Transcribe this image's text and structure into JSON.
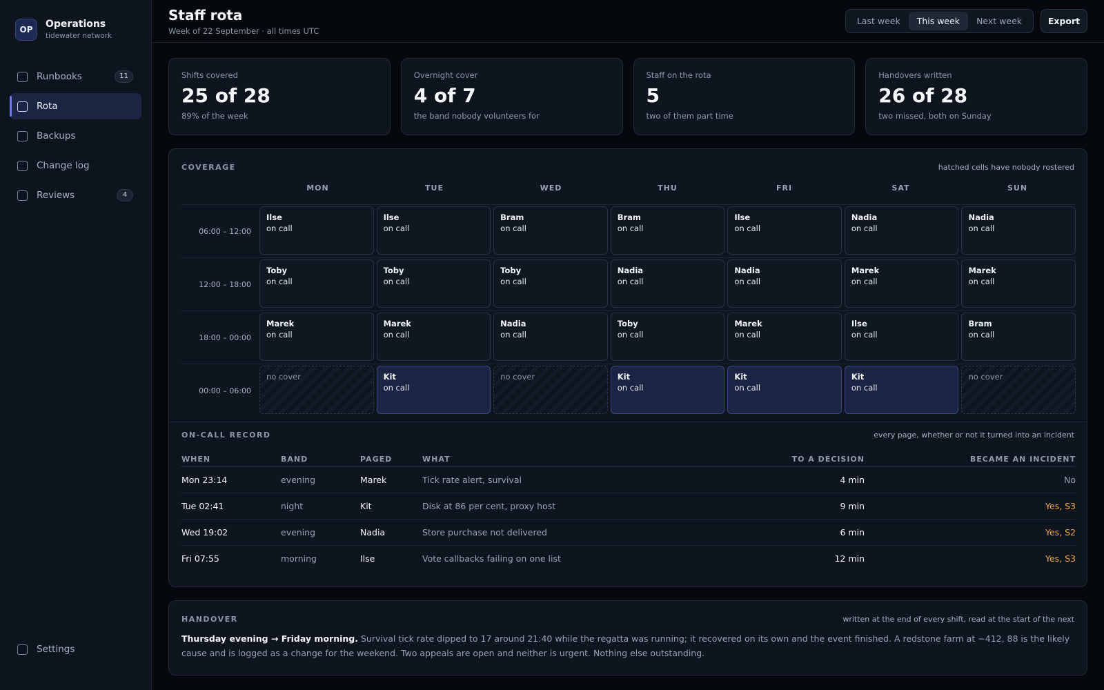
{
  "brand": {
    "mark": "OP",
    "name": "Operations",
    "sub": "tidewater network"
  },
  "nav": [
    {
      "label": "Runbooks",
      "count": "11",
      "active": false
    },
    {
      "label": "Rota",
      "count": "",
      "active": true
    },
    {
      "label": "Backups",
      "count": "",
      "active": false
    },
    {
      "label": "Change log",
      "count": "",
      "active": false
    },
    {
      "label": "Reviews",
      "count": "4",
      "active": false
    }
  ],
  "settings_label": "Settings",
  "header": {
    "title": "Staff rota",
    "subtitle": "Week of 22 September · all times UTC",
    "weeks": [
      "Last week",
      "This week",
      "Next week"
    ],
    "active_week": "This week",
    "export_label": "Export"
  },
  "stats": [
    {
      "label": "Shifts covered",
      "value": "25 of 28",
      "note": "89% of the week"
    },
    {
      "label": "Overnight cover",
      "value": "4 of 7",
      "note": "the band nobody volunteers for"
    },
    {
      "label": "Staff on the rota",
      "value": "5",
      "note": "two of them part time"
    },
    {
      "label": "Handovers written",
      "value": "26 of 28",
      "note": "two missed, both on Sunday"
    }
  ],
  "coverage": {
    "title": "COVERAGE",
    "note": "hatched cells have nobody rostered",
    "days": [
      "MON",
      "TUE",
      "WED",
      "THU",
      "FRI",
      "SAT",
      "SUN"
    ],
    "on_call_label": "on call",
    "no_cover_label": "no cover",
    "bands": [
      {
        "label": "06:00 – 12:00",
        "night": false,
        "cells": [
          "Ilse",
          "Ilse",
          "Bram",
          "Bram",
          "Ilse",
          "Nadia",
          "Nadia"
        ]
      },
      {
        "label": "12:00 – 18:00",
        "night": false,
        "cells": [
          "Toby",
          "Toby",
          "Toby",
          "Nadia",
          "Nadia",
          "Marek",
          "Marek"
        ]
      },
      {
        "label": "18:00 – 00:00",
        "night": false,
        "cells": [
          "Marek",
          "Marek",
          "Nadia",
          "Toby",
          "Marek",
          "Ilse",
          "Bram"
        ]
      },
      {
        "label": "00:00 – 06:00",
        "night": true,
        "cells": [
          "",
          "Kit",
          "",
          "Kit",
          "Kit",
          "Kit",
          ""
        ]
      }
    ]
  },
  "oncall": {
    "title": "ON-CALL RECORD",
    "note": "every page, whether or not it turned into an incident",
    "columns": [
      "WHEN",
      "BAND",
      "PAGED",
      "WHAT",
      "TO A DECISION",
      "BECAME AN INCIDENT"
    ],
    "rows": [
      {
        "when": "Mon 23:14",
        "band": "evening",
        "paged": "Marek",
        "what": "Tick rate alert, survival",
        "decision": "4 min",
        "incident": "No"
      },
      {
        "when": "Tue 02:41",
        "band": "night",
        "paged": "Kit",
        "what": "Disk at 86 per cent, proxy host",
        "decision": "9 min",
        "incident": "Yes, S3"
      },
      {
        "when": "Wed 19:02",
        "band": "evening",
        "paged": "Nadia",
        "what": "Store purchase not delivered",
        "decision": "6 min",
        "incident": "Yes, S2"
      },
      {
        "when": "Fri 07:55",
        "band": "morning",
        "paged": "Ilse",
        "what": "Vote callbacks failing on one list",
        "decision": "12 min",
        "incident": "Yes, S3"
      }
    ]
  },
  "handover": {
    "title": "HANDOVER",
    "note": "written at the end of every shift, read at the start of the next",
    "lead": "Thursday evening → Friday morning.",
    "body": " Survival tick rate dipped to 17 around 21:40 while the regatta was running; it recovered on its own and the event finished. A redstone farm at −412, 88 is the likely cause and is logged as a change for the weekend. Two appeals are open and neither is urgent. Nothing else outstanding."
  },
  "colors": {
    "accent": "#6f7cf0",
    "night_cell": "#1c2444",
    "incident_yes": "#f0a64a"
  }
}
